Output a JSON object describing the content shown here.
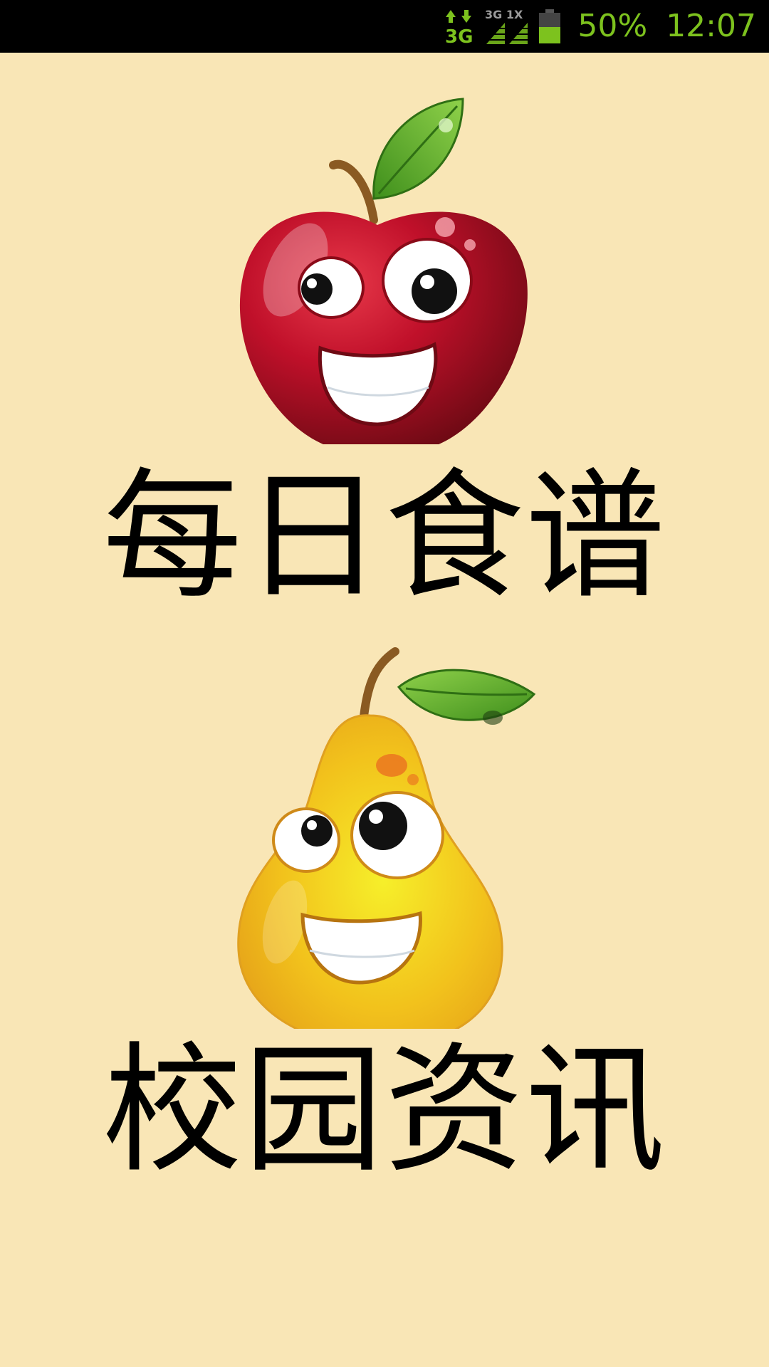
{
  "status_bar": {
    "network_label": "3G",
    "signal_label": "3G 1X",
    "battery_percent": "50%",
    "time": "12:07",
    "accent_color": "#7dc21e"
  },
  "menu": {
    "items": [
      {
        "label": "每日食谱",
        "icon": "apple-icon"
      },
      {
        "label": "校园资讯",
        "icon": "pear-icon"
      }
    ]
  },
  "colors": {
    "background": "#f9e6b6",
    "status_bar": "#000000",
    "label_text": "#000000"
  }
}
